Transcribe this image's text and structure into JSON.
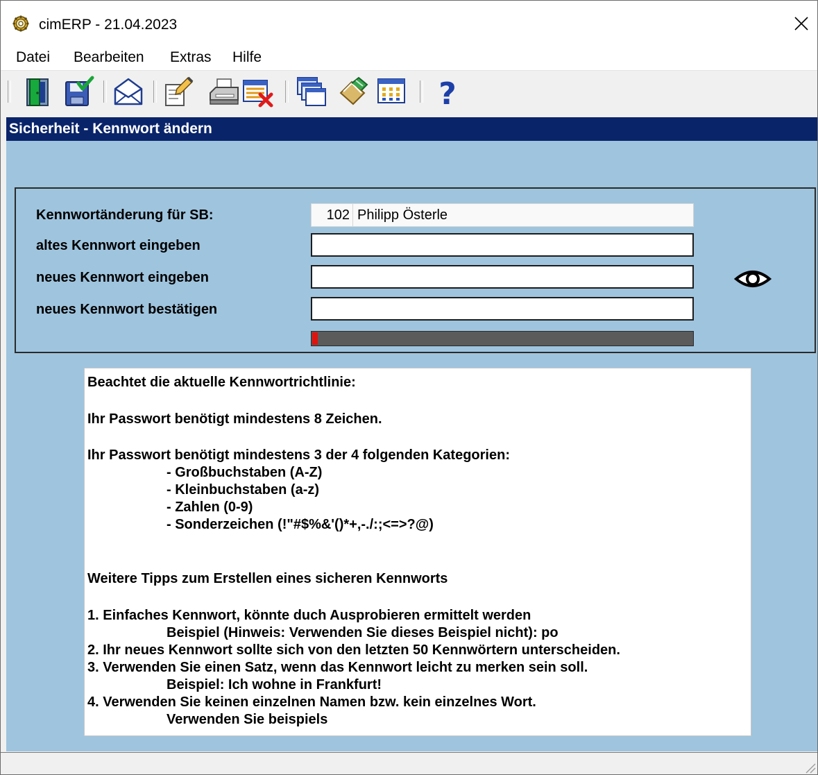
{
  "window": {
    "title": "cimERP - 21.04.2023"
  },
  "menu": [
    {
      "label": "Datei"
    },
    {
      "label": "Bearbeiten"
    },
    {
      "label": "Extras"
    },
    {
      "label": "Hilfe"
    }
  ],
  "toolbar": {
    "buttons": [
      {
        "name": "exit-door-icon"
      },
      {
        "name": "save-icon"
      },
      {
        "name": "mail-icon"
      },
      {
        "name": "edit-document-icon"
      },
      {
        "name": "print-icon"
      },
      {
        "name": "delete-record-icon"
      },
      {
        "name": "windows-icon"
      },
      {
        "name": "attachment-icon"
      },
      {
        "name": "calendar-grid-icon"
      },
      {
        "name": "help-icon"
      }
    ]
  },
  "section": {
    "title": "Sicherheit - Kennwort ändern"
  },
  "form": {
    "user_label": "Kennwortänderung für SB:",
    "user_number": "102",
    "user_name": "Philipp Österle",
    "old_label": "altes Kennwort eingeben",
    "old_value": "",
    "new_label": "neues Kennwort eingeben",
    "new_value": "",
    "confirm_label": "neues Kennwort bestätigen",
    "confirm_value": "",
    "strength_fraction": 0.015
  },
  "info": {
    "lines": [
      "Beachtet die aktuelle Kennwortrichtlinie:",
      "Ihr Passwort benötigt mindestens 8 Zeichen.",
      "Ihr Passwort benötigt mindestens 3 der 4 folgenden Kategorien:",
      "- Großbuchstaben (A-Z)",
      "- Kleinbuchstaben (a-z)",
      "- Zahlen (0-9)",
      "- Sonderzeichen (!\"#$%&'()*+,-./:;<=>?@)",
      "Weitere Tipps zum Erstellen eines sicheren Kennworts",
      "1. Einfaches Kennwort, könnte duch Ausprobieren ermittelt werden",
      "Beispiel (Hinweis: Verwenden Sie dieses Beispiel nicht): po",
      "2. Ihr neues Kennwort sollte sich von den letzten 50 Kennwörtern unterscheiden.",
      "3. Verwenden Sie einen Satz, wenn das Kennwort leicht zu merken sein soll.",
      "Beispiel: Ich wohne in Frankfurt!",
      "4. Verwenden Sie keinen einzelnen Namen bzw. kein einzelnes Wort.",
      "Verwenden Sie beispiels"
    ]
  },
  "colors": {
    "header_bar": "#0a246a",
    "content_bg": "#9fc4de",
    "strength_low": "#e0120e"
  }
}
